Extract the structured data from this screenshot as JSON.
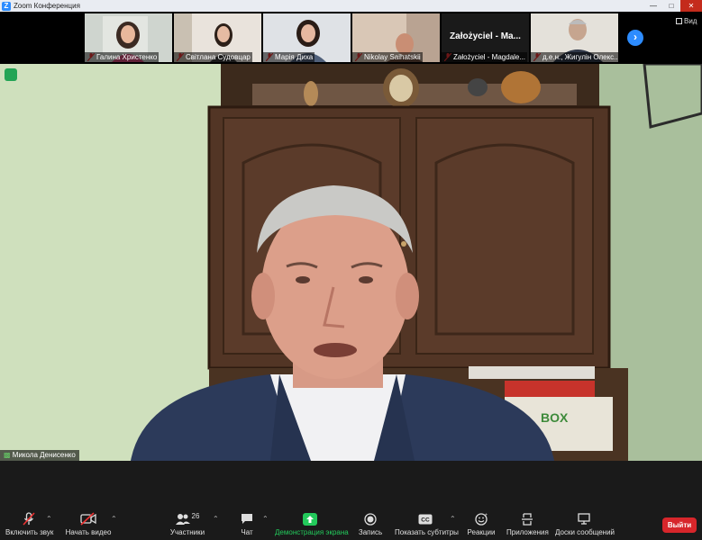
{
  "window": {
    "title": "Zoom Конференция"
  },
  "gallery": {
    "tiles": [
      {
        "name": "Галина Христенко"
      },
      {
        "name": "Світлана Судовцар"
      },
      {
        "name": "Марія Диха"
      },
      {
        "name": "Nikolay Saihatskii"
      },
      {
        "name": "Założyciel - Magdale...",
        "display": "Założyciel - Ma..."
      },
      {
        "name": "д.е.н., Жигулін Олекс..."
      }
    ],
    "view_label": "Вид"
  },
  "speaker": {
    "name": "Микола Денисенко"
  },
  "toolbar": {
    "mute": "Включить звук",
    "video": "Начать видео",
    "participants": "Участники",
    "participants_count": "26",
    "chat": "Чат",
    "share": "Демонстрация экрана",
    "record": "Запись",
    "subtitles": "Показать субтитры",
    "reactions": "Реакции",
    "apps": "Приложения",
    "whiteboard": "Доски сообщений",
    "leave": "Выйти"
  },
  "colors": {
    "accent": "#2d8cff",
    "share_green": "#23c95b",
    "leave_red": "#d7262b"
  }
}
